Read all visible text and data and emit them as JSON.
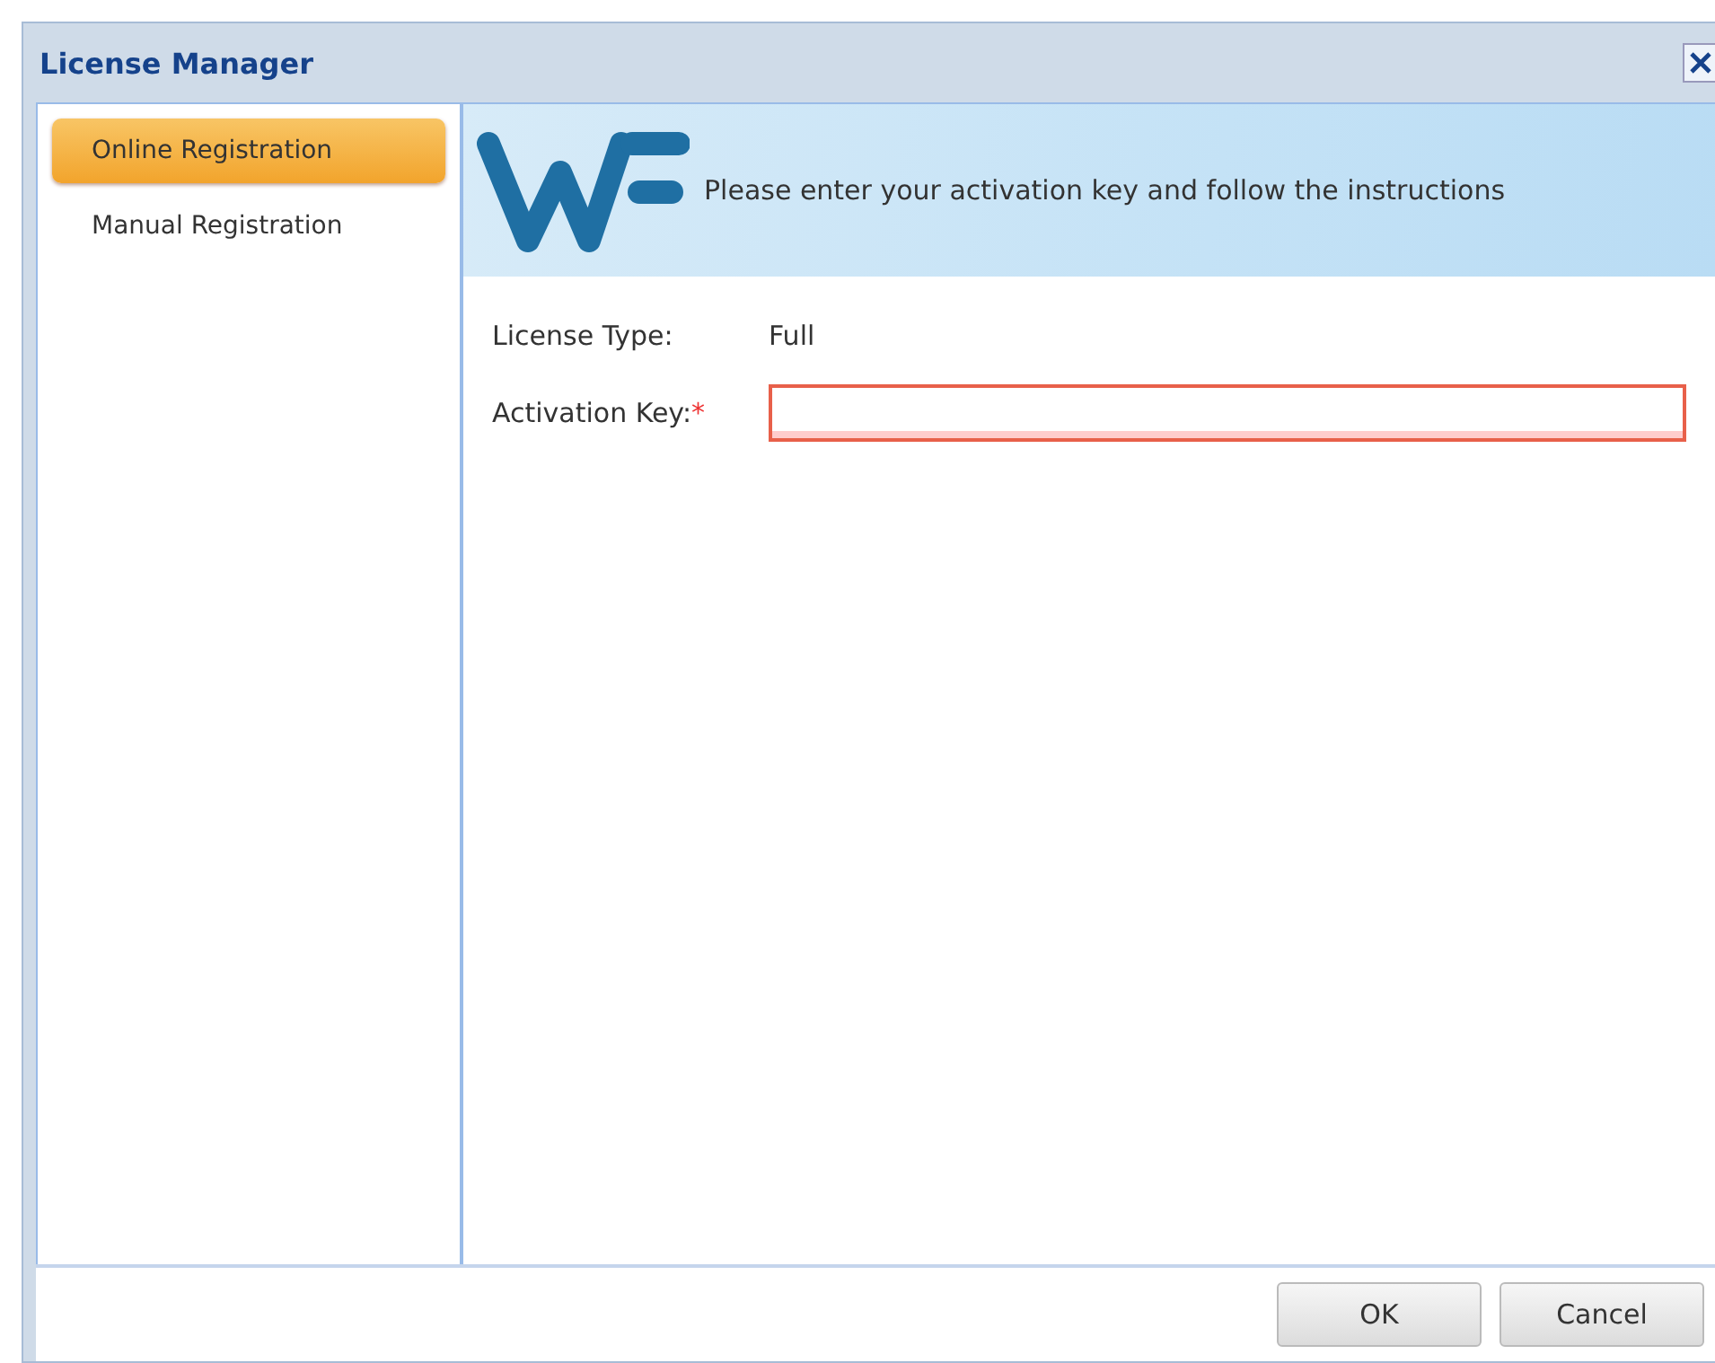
{
  "window": {
    "title": "License Manager"
  },
  "sidebar": {
    "items": [
      {
        "label": "Online Registration",
        "selected": true
      },
      {
        "label": "Manual Registration",
        "selected": false
      }
    ]
  },
  "banner": {
    "text": "Please enter your activation key and follow the instructions"
  },
  "form": {
    "fields": [
      {
        "kind": "text",
        "label": "License Type:",
        "value": "Full"
      },
      {
        "kind": "input",
        "label": "Activation Key:",
        "required_mark": "*",
        "required": true,
        "invalid": true
      }
    ]
  },
  "buttons": [
    {
      "label": "OK"
    },
    {
      "label": "Cancel"
    }
  ]
}
